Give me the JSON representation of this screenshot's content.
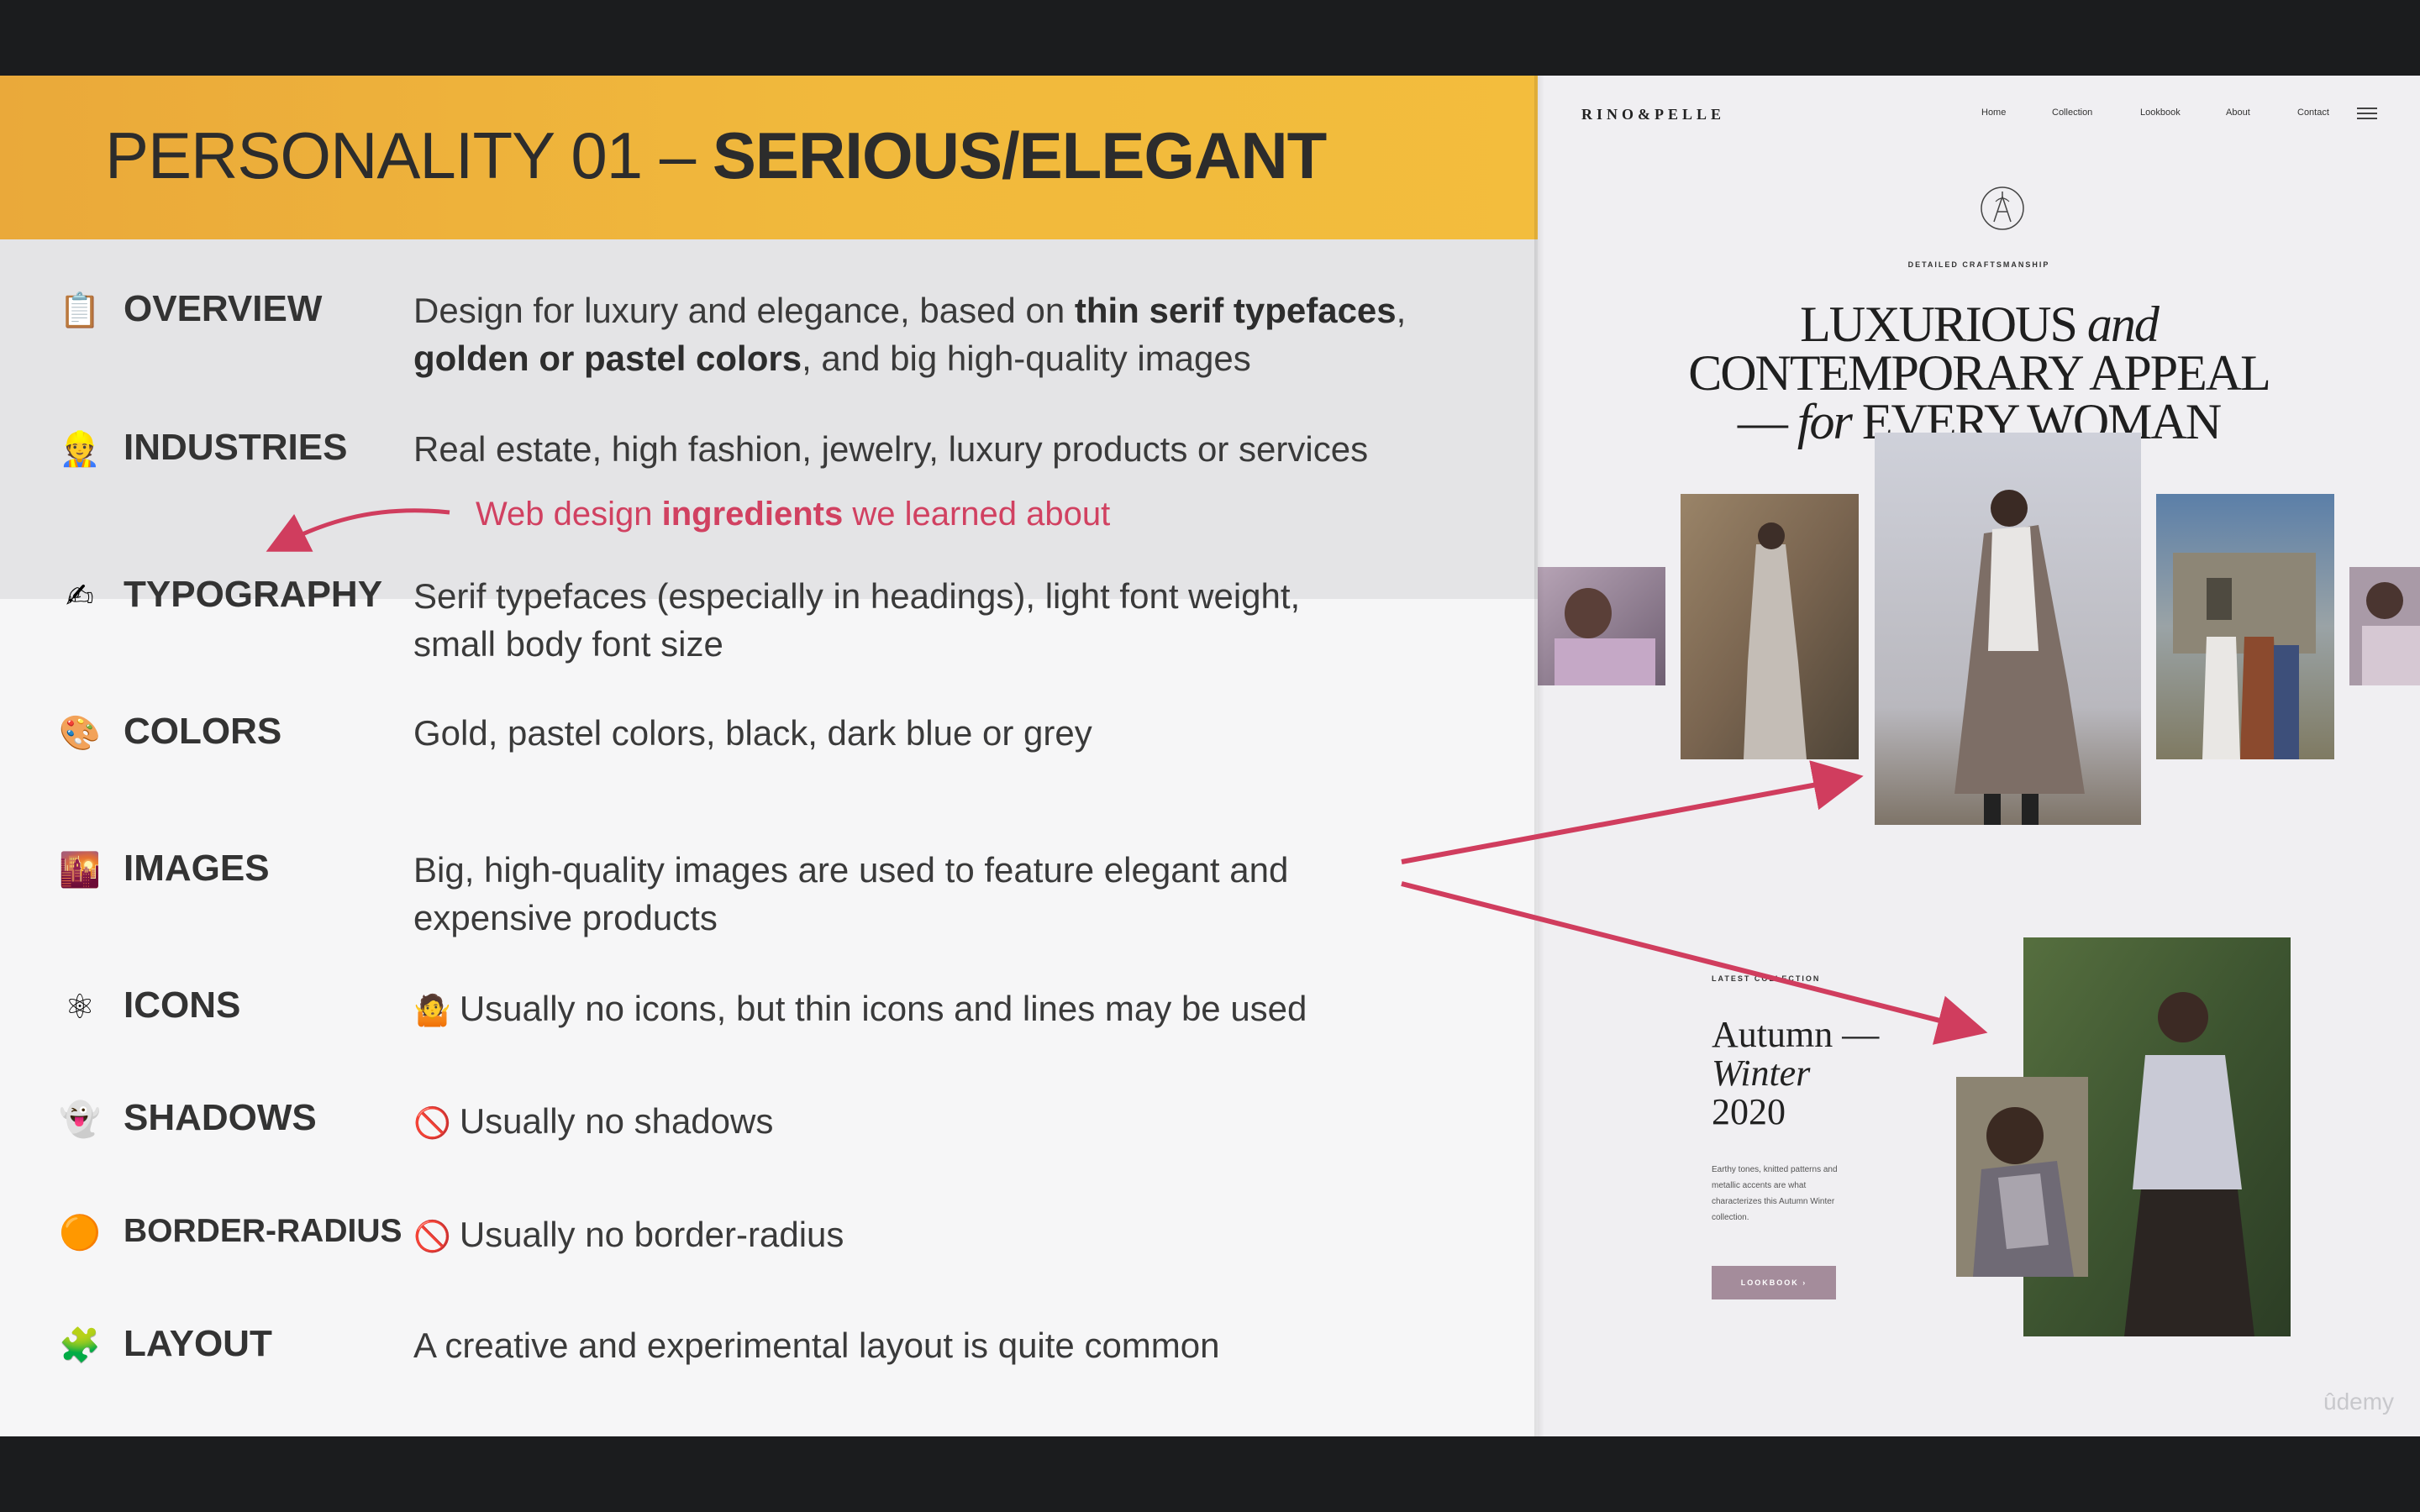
{
  "slide": {
    "title_light": "PERSONALITY 01 – ",
    "title_bold": "SERIOUS/ELEGANT",
    "annotation": {
      "before": "Web design ",
      "bold": "ingredients",
      "after": " we learned about"
    },
    "rows": [
      {
        "emoji": "📋",
        "label": "OVERVIEW",
        "text_parts": [
          "Design for luxury and elegance, based on ",
          "thin serif typefaces",
          ",",
          "golden or pastel colors",
          ", and big high-quality images"
        ]
      },
      {
        "emoji": "👷",
        "label": "INDUSTRIES",
        "text": "Real estate, high fashion, jewelry, luxury products or services"
      },
      {
        "emoji": "✍",
        "label": "TYPOGRAPHY",
        "text": "Serif typefaces (especially in headings), light font weight, small body font size"
      },
      {
        "emoji": "🎨",
        "label": "COLORS",
        "text": "Gold, pastel colors, black, dark blue or grey"
      },
      {
        "emoji": "🌇",
        "label": "IMAGES",
        "text": "Big, high-quality images are used to feature elegant and expensive products"
      },
      {
        "emoji": "⚛",
        "label": "ICONS",
        "inline_emoji": "🤷",
        "text": "Usually no icons, but thin icons and lines may be used"
      },
      {
        "emoji": "👻",
        "label": "SHADOWS",
        "inline_emoji": "🚫",
        "text": "Usually no shadows"
      },
      {
        "emoji": "🟠",
        "label": "BORDER-RADIUS",
        "inline_emoji": "🚫",
        "text": "Usually no border-radius"
      },
      {
        "emoji": "🧩",
        "label": "LAYOUT",
        "text": "A creative and experimental layout is quite common"
      }
    ],
    "colors": {
      "header": "#f1b93c",
      "annotation": "#d14161",
      "arrow": "#d03d5e"
    }
  },
  "site": {
    "logo": "RINO&PELLE",
    "nav": [
      "Home",
      "Collection",
      "Lookbook",
      "About",
      "Contact"
    ],
    "menu_icon": "hamburger-icon",
    "crest_icon": "crest-icon",
    "eyebrow": "DETAILED CRAFTSMANSHIP",
    "hero": {
      "line1_a": "LUXURIOUS ",
      "line1_b": "and",
      "line2": "CONTEMPORARY APPEAL",
      "line3_a": "— ",
      "line3_b": "for",
      "line3_c": " EVERY WOMAN"
    },
    "latest": "LATEST COLLECTION",
    "collection": {
      "line1": "Autumn —",
      "line2": "Winter",
      "line3": "2020"
    },
    "description": "Earthy tones, knitted patterns and metallic accents are what characterizes this Autumn Winter collection.",
    "button": "LOOKBOOK  ›"
  },
  "watermark": "ûdemy"
}
